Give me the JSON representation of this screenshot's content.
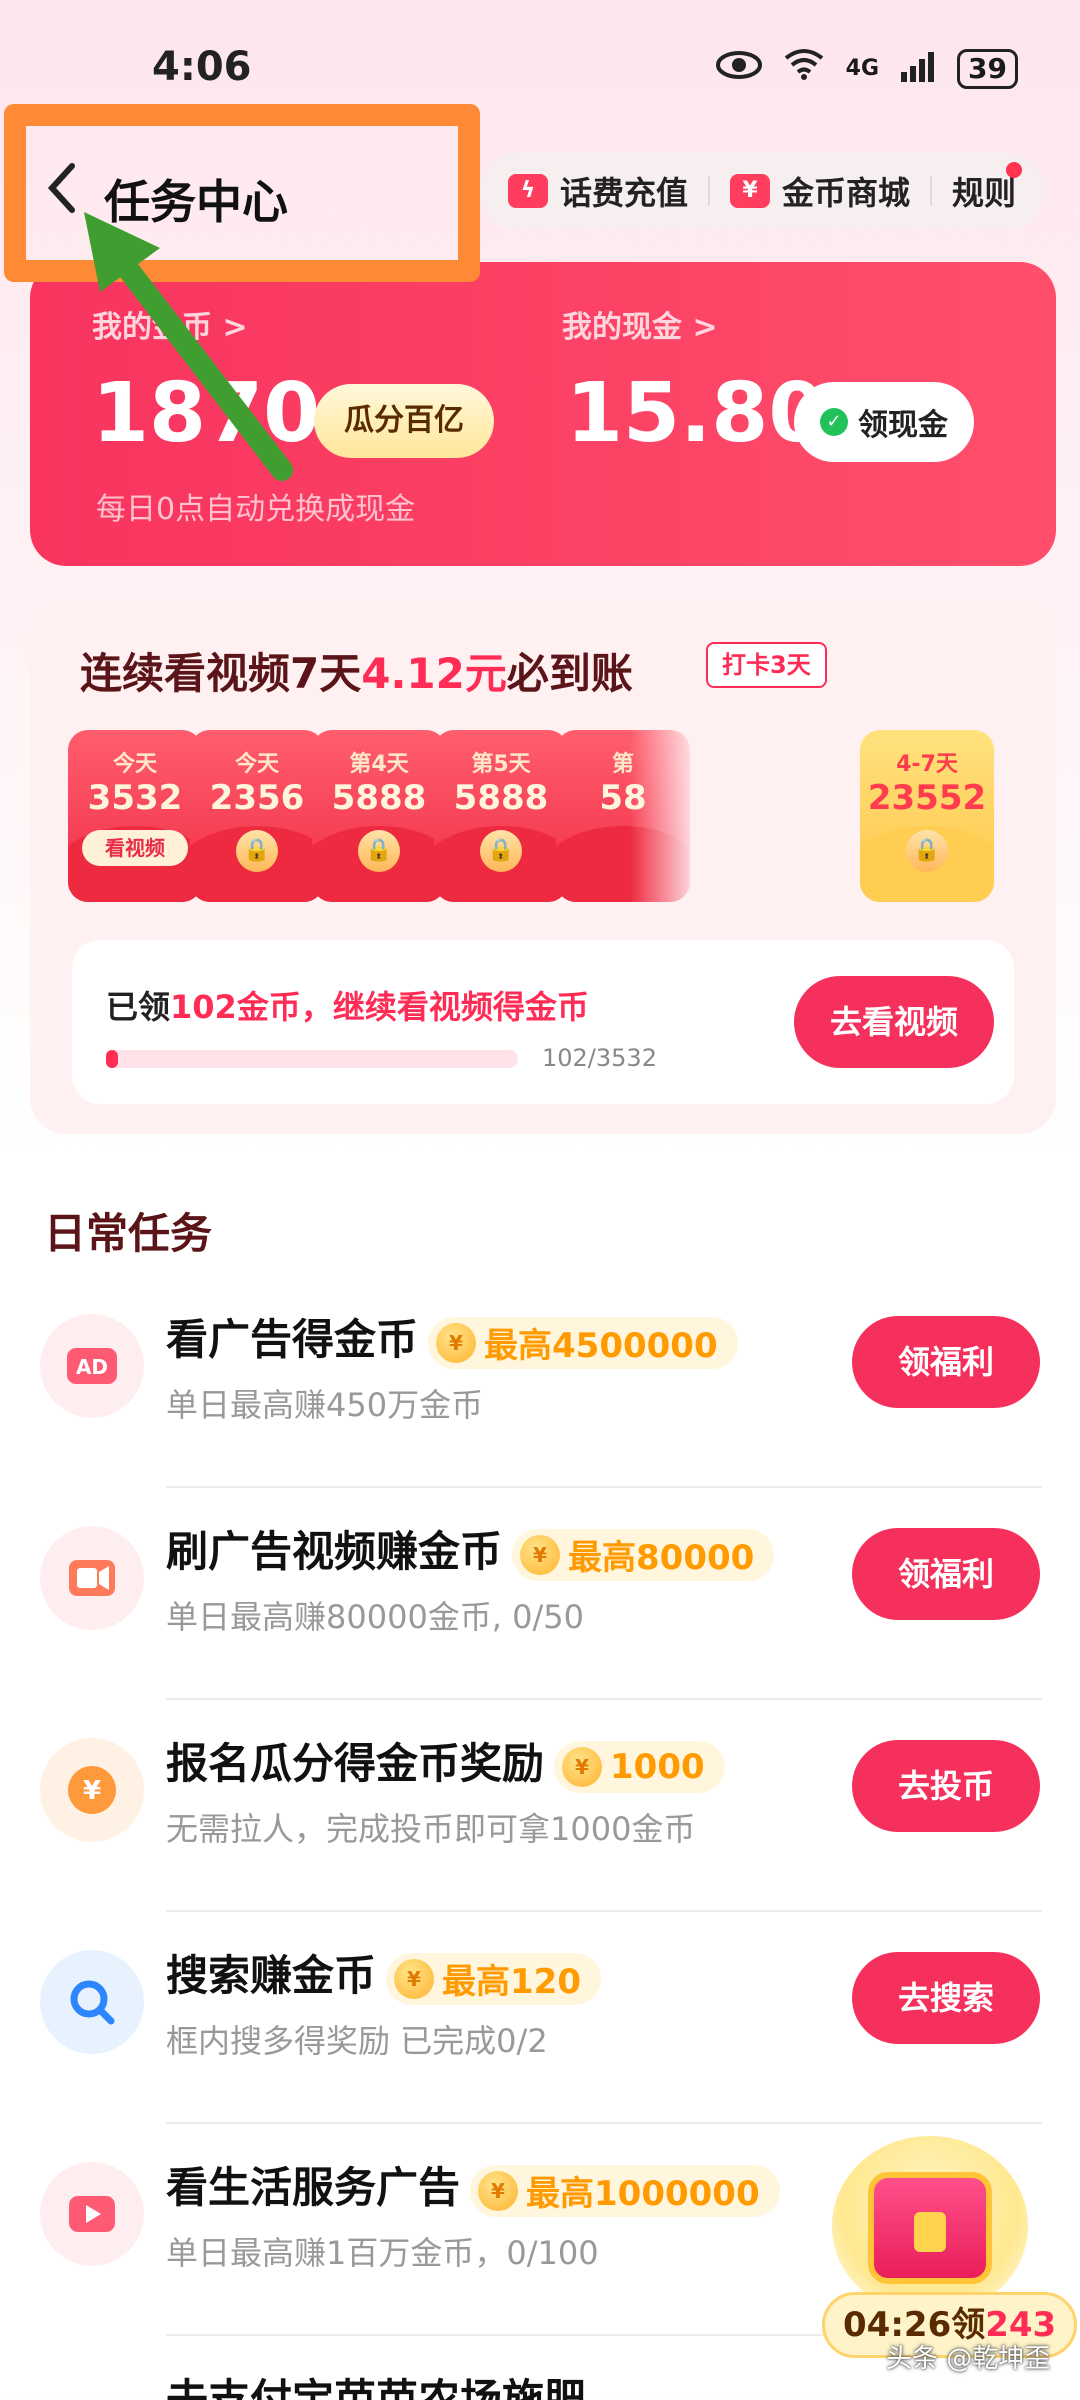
{
  "status_bar": {
    "time": "4:06",
    "network": "4G",
    "battery": "39"
  },
  "header": {
    "title": "任务中心",
    "links": [
      {
        "label": "话费充值"
      },
      {
        "label": "金币商城"
      },
      {
        "label": "规则"
      }
    ]
  },
  "wallet": {
    "coins_label": "我的金币 >",
    "coins_value": "1870",
    "coins_button": "瓜分百亿",
    "coins_note": "每日0点自动兑换成现金",
    "cash_label": "我的现金 >",
    "cash_value": "15.80",
    "cash_button": "领现金"
  },
  "streak": {
    "title_part1": "连续看视频",
    "title_part2": "7天",
    "title_part3": "4.12元",
    "title_part4": "必到账",
    "tag": "打卡3天",
    "envelopes": [
      {
        "day": "今天",
        "amount": "3532",
        "action": "看视频"
      },
      {
        "day": "今天",
        "amount": "2356"
      },
      {
        "day": "第4天",
        "amount": "5888"
      },
      {
        "day": "第5天",
        "amount": "5888"
      },
      {
        "day": "第",
        "amount": "58"
      },
      {
        "day": "4-7天",
        "amount": "23552"
      }
    ],
    "progress_text_prefix": "已领",
    "progress_text_highlight": "102金币，继续看视频得金币",
    "progress_current": 102,
    "progress_total": 3532,
    "progress_label": "102/3532",
    "button": "去看视频"
  },
  "daily": {
    "title": "日常任务",
    "tasks": [
      {
        "icon": "ad-icon",
        "title": "看广告得金币",
        "badge": "最高4500000",
        "sub": "单日最高赚450万金币",
        "button": "领福利"
      },
      {
        "icon": "video-icon",
        "title": "刷广告视频赚金币",
        "badge": "最高80000",
        "sub": "单日最高赚80000金币, 0/50",
        "button": "领福利"
      },
      {
        "icon": "yen-icon",
        "title": "报名瓜分得金币奖励",
        "badge": "1000",
        "sub": "无需拉人，完成投币即可拿1000金币",
        "button": "去投币"
      },
      {
        "icon": "search-icon",
        "title": "搜索赚金币",
        "badge": "最高120",
        "sub": "框内搜多得奖励 已完成0/2",
        "button": "去搜索"
      },
      {
        "icon": "play-icon",
        "title": "看生活服务广告",
        "badge": "最高1000000",
        "sub": "单日最高赚1百万金币，0/100",
        "button": ""
      }
    ],
    "partial_task": "去支付宝芭芭农场施肥"
  },
  "chest": {
    "timer": "04:26领",
    "amount": "243"
  },
  "watermark": "头条 @乾坤歪",
  "colors": {
    "accent": "#f5305c",
    "annotation": "#ff8a35",
    "arrow": "#3f9e2f"
  }
}
